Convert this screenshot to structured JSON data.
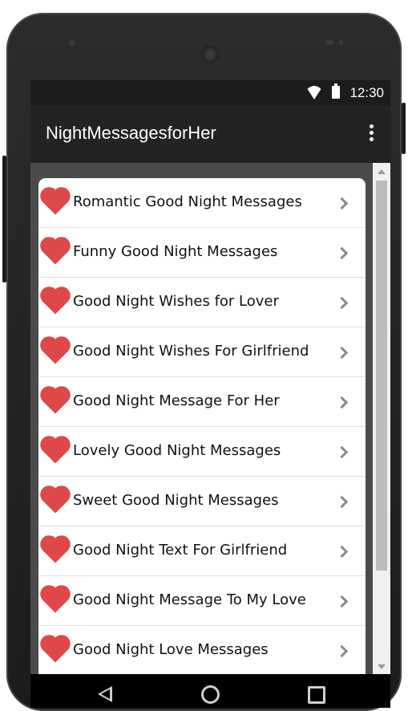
{
  "status_bar": {
    "time": "12:30",
    "icons": [
      "wifi-icon",
      "battery-icon"
    ]
  },
  "app_bar": {
    "title": "NightMessagesforHer",
    "menu_icon": "overflow-icon"
  },
  "list": {
    "item_icon": "heart-icon",
    "accent_color": "#de4848",
    "items": [
      {
        "label": "Romantic Good Night Messages"
      },
      {
        "label": "Funny Good Night Messages"
      },
      {
        "label": "Good Night Wishes for Lover"
      },
      {
        "label": "Good Night Wishes For Girlfriend"
      },
      {
        "label": "Good Night Message For Her"
      },
      {
        "label": "Lovely Good Night Messages"
      },
      {
        "label": "Sweet Good Night Messages"
      },
      {
        "label": "Good Night Text For Girlfriend"
      },
      {
        "label": "Good Night Message To My Love"
      },
      {
        "label": "Good Night Love Messages"
      }
    ]
  },
  "nav_bar": {
    "icons": [
      "back-icon",
      "home-icon",
      "recents-icon"
    ]
  }
}
